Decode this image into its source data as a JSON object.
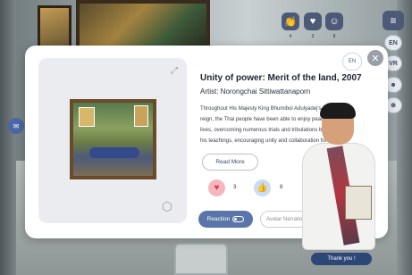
{
  "top_bar": {
    "reactions": [
      {
        "icon": "clap-icon",
        "glyph": "👏",
        "count": "4"
      },
      {
        "icon": "heart-icon",
        "glyph": "♥",
        "count": "3"
      },
      {
        "icon": "smile-icon",
        "glyph": "☺",
        "count": "8"
      }
    ],
    "menu_icon": "≡"
  },
  "side_controls": {
    "lang": "EN",
    "vr": "VR",
    "people_icon": "☻",
    "globe_icon": "⊕"
  },
  "modal": {
    "lang_badge": "EN",
    "close": "✕",
    "title": "Unity of power: Merit of the land, 2007",
    "artist": "Artist: Norongchai Sittiwattanaporn",
    "description_lines": [
      "Throughout His Majesty King Bhumibol Adulyadej's 70-year",
      "reign, the Thai people have been able to enjoy peaceful happy",
      "lives, overcoming numerous trials and tribulations because of",
      "his teachings, encouraging unity and collaboration for the Thai"
    ],
    "read_more": "Read More",
    "reactions": {
      "heart_count": "3",
      "like_count": "8"
    },
    "reaction_button": "Reaction",
    "avatar_placeholder": "Avatar Narration"
  },
  "avatar": {
    "thank_button": "Thank you !"
  },
  "colors": {
    "accent": "#5a75a8",
    "dark_button": "#2c4676",
    "heart": "#e23a55",
    "like": "#2f63c4"
  }
}
